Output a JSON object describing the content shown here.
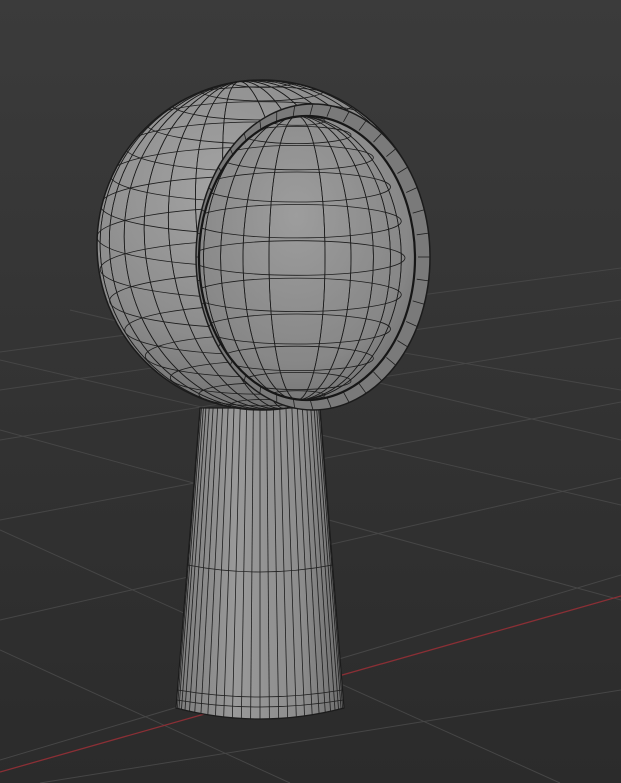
{
  "viewport": {
    "object_name": "",
    "background_top": "#3b3b3b",
    "background_bottom": "#2c2c2c",
    "grid_color": "#474747",
    "x_axis_color": "#8a2f35",
    "mesh_fill": "#8e8e8e",
    "wire_color": "#1b1b1b"
  }
}
